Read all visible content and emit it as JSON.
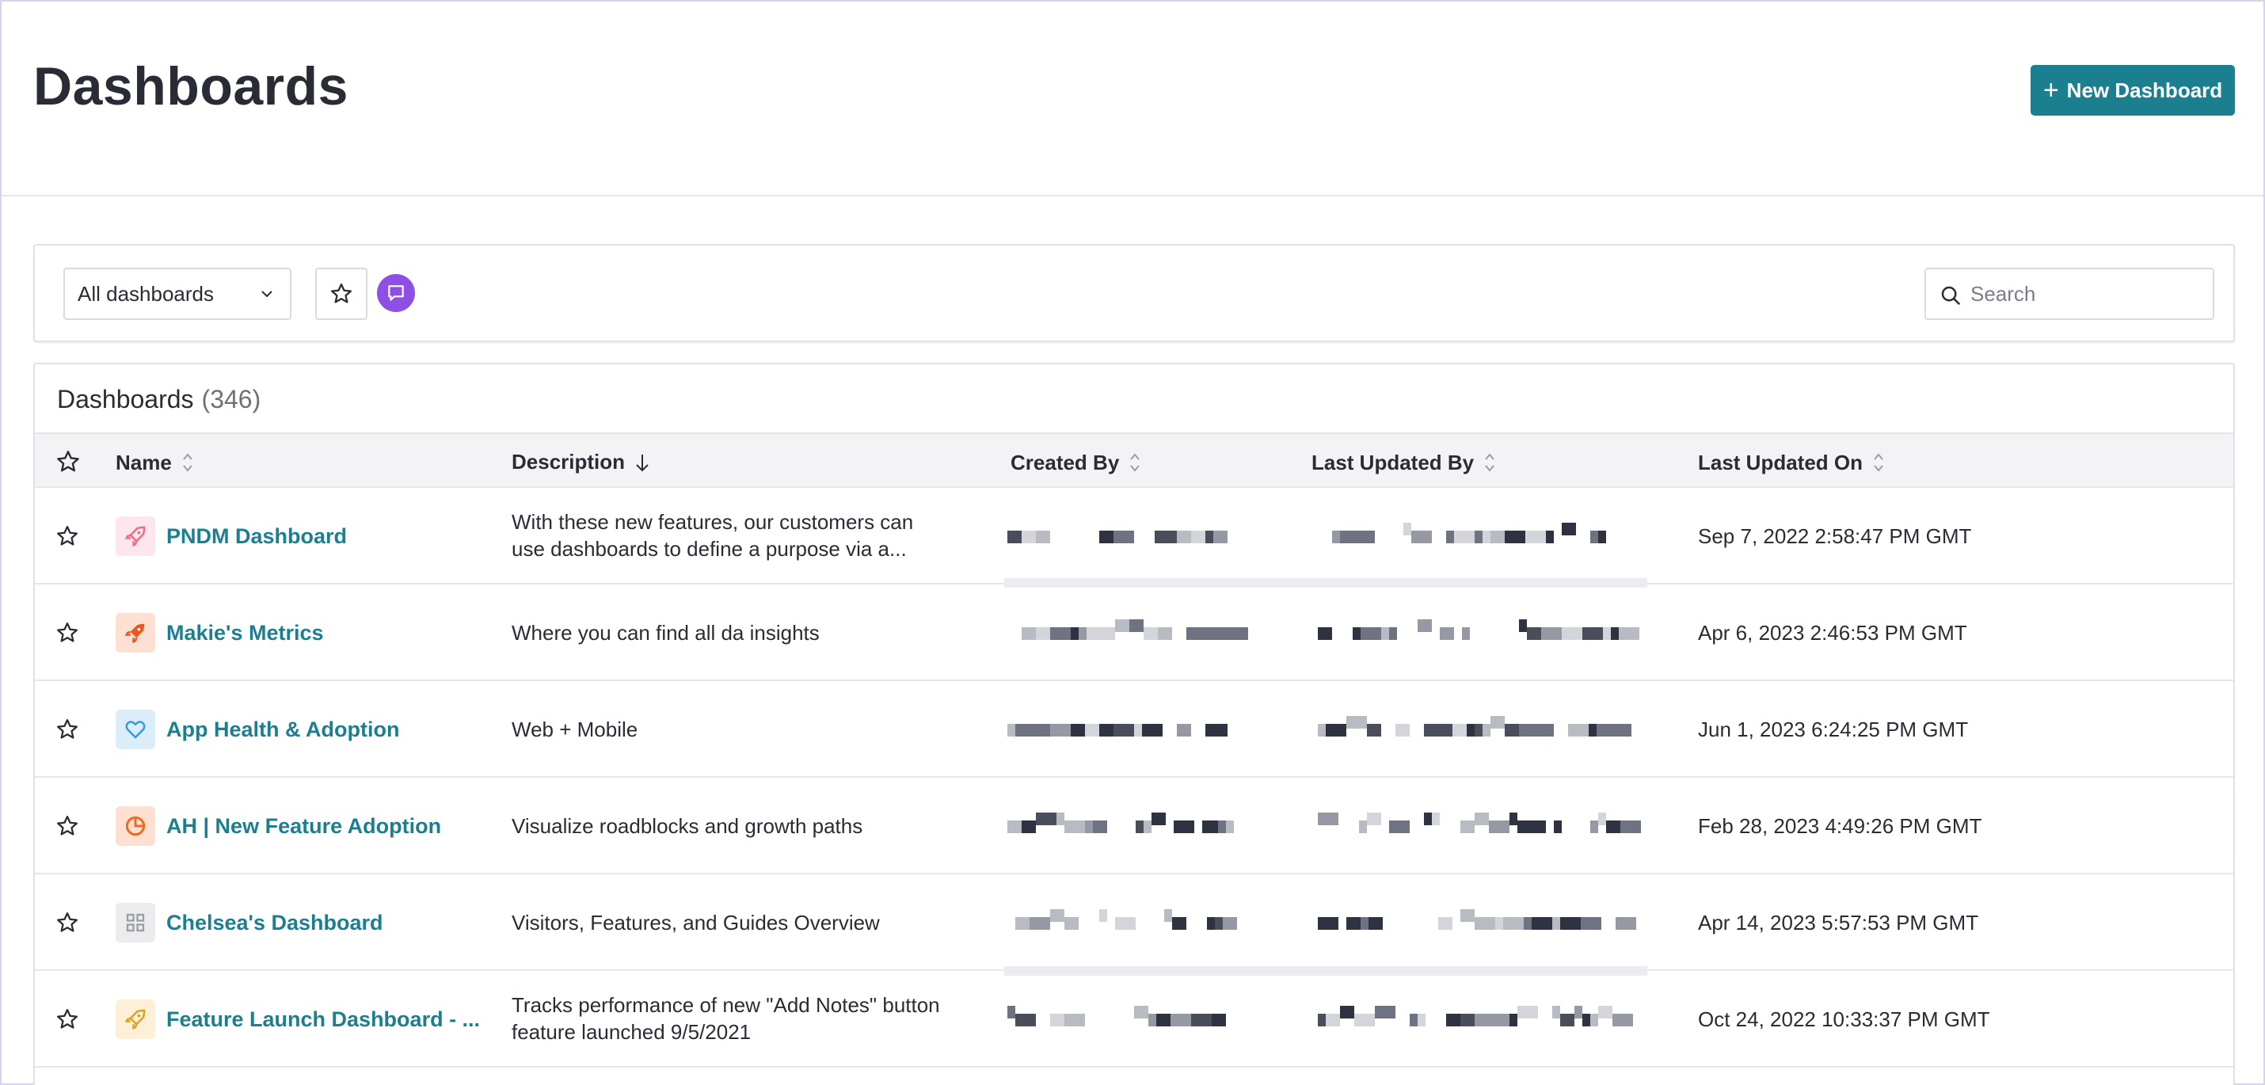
{
  "header": {
    "title": "Dashboards",
    "new_button_label": "New Dashboard",
    "new_button_color": "#1c7f8f"
  },
  "filters": {
    "dropdown_value": "All dashboards",
    "search_placeholder": "Search",
    "chat_filter_color": "#8e4fe6"
  },
  "panel": {
    "title": "Dashboards",
    "count": "(346)"
  },
  "columns": {
    "name": "Name",
    "description": "Description",
    "created_by": "Created By",
    "last_updated_by": "Last Updated By",
    "last_updated_on": "Last Updated On"
  },
  "rows": [
    {
      "name": "PNDM Dashboard",
      "icon": "rocket-icon",
      "icon_color": "#f06a8a",
      "icon_bg": "#fde6ec",
      "description_line1": "With these new features, our customers can",
      "description_line2": "use dashboards to define a purpose via a...",
      "updated_on": "Sep 7, 2022 2:58:47 PM GMT"
    },
    {
      "name": "Makie's Metrics",
      "icon": "rocket-icon",
      "icon_color": "#e8571f",
      "icon_bg": "#fde0d2",
      "description_line1": "Where you can find all da insights",
      "description_line2": "",
      "updated_on": "Apr 6, 2023 2:46:53 PM GMT"
    },
    {
      "name": "App Health & Adoption",
      "icon": "heart-icon",
      "icon_color": "#2f9be0",
      "icon_bg": "#dcedfa",
      "description_line1": "Web + Mobile",
      "description_line2": "",
      "updated_on": "Jun 1, 2023 6:24:25 PM GMT"
    },
    {
      "name": "AH | New Feature Adoption",
      "icon": "pie-chart-icon",
      "icon_color": "#f06a1c",
      "icon_bg": "#fde0d2",
      "description_line1": "Visualize roadblocks and growth paths",
      "description_line2": "",
      "updated_on": "Feb 28, 2023 4:49:26 PM GMT"
    },
    {
      "name": "Chelsea's Dashboard",
      "icon": "grid-icon",
      "icon_color": "#9a9ca5",
      "icon_bg": "#ececef",
      "description_line1": "Visitors, Features, and Guides Overview",
      "description_line2": "",
      "updated_on": "Apr 14, 2023 5:57:53 PM GMT"
    },
    {
      "name": "Feature Launch Dashboard - ...",
      "icon": "rocket-icon",
      "icon_color": "#e0a020",
      "icon_bg": "#fdf0d6",
      "description_line1": "Tracks performance of new \"Add Notes\" button",
      "description_line2": "feature launched 9/5/2021",
      "updated_on": "Oct 24, 2022 10:33:37 PM GMT"
    }
  ]
}
